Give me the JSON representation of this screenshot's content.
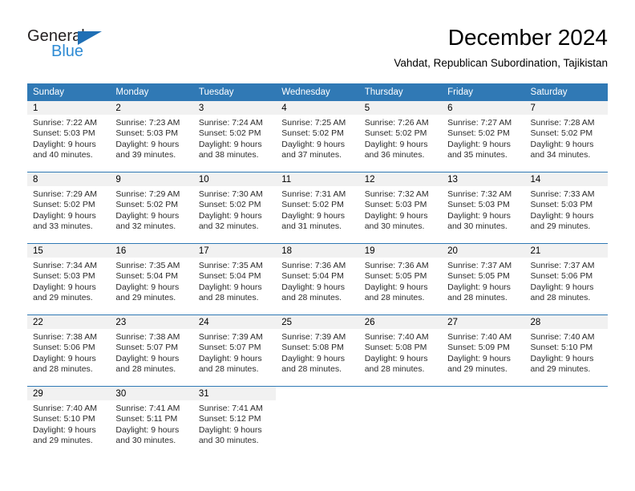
{
  "logo": {
    "text_top": "General",
    "text_bottom": "Blue",
    "triangle_color": "#1f6fb5",
    "blue_color": "#2e8bd4"
  },
  "header": {
    "title": "December 2024",
    "subtitle": "Vahdat, Republican Subordination, Tajikistan"
  },
  "theme": {
    "header_blue": "#3079b5",
    "daynum_band": "#f1f1f1",
    "text": "#000000"
  },
  "calendar": {
    "weekday_headers": [
      "Sunday",
      "Monday",
      "Tuesday",
      "Wednesday",
      "Thursday",
      "Friday",
      "Saturday"
    ],
    "weeks": [
      [
        {
          "day": "1",
          "sunrise": "Sunrise: 7:22 AM",
          "sunset": "Sunset: 5:03 PM",
          "daylight_1": "Daylight: 9 hours",
          "daylight_2": "and 40 minutes."
        },
        {
          "day": "2",
          "sunrise": "Sunrise: 7:23 AM",
          "sunset": "Sunset: 5:03 PM",
          "daylight_1": "Daylight: 9 hours",
          "daylight_2": "and 39 minutes."
        },
        {
          "day": "3",
          "sunrise": "Sunrise: 7:24 AM",
          "sunset": "Sunset: 5:02 PM",
          "daylight_1": "Daylight: 9 hours",
          "daylight_2": "and 38 minutes."
        },
        {
          "day": "4",
          "sunrise": "Sunrise: 7:25 AM",
          "sunset": "Sunset: 5:02 PM",
          "daylight_1": "Daylight: 9 hours",
          "daylight_2": "and 37 minutes."
        },
        {
          "day": "5",
          "sunrise": "Sunrise: 7:26 AM",
          "sunset": "Sunset: 5:02 PM",
          "daylight_1": "Daylight: 9 hours",
          "daylight_2": "and 36 minutes."
        },
        {
          "day": "6",
          "sunrise": "Sunrise: 7:27 AM",
          "sunset": "Sunset: 5:02 PM",
          "daylight_1": "Daylight: 9 hours",
          "daylight_2": "and 35 minutes."
        },
        {
          "day": "7",
          "sunrise": "Sunrise: 7:28 AM",
          "sunset": "Sunset: 5:02 PM",
          "daylight_1": "Daylight: 9 hours",
          "daylight_2": "and 34 minutes."
        }
      ],
      [
        {
          "day": "8",
          "sunrise": "Sunrise: 7:29 AM",
          "sunset": "Sunset: 5:02 PM",
          "daylight_1": "Daylight: 9 hours",
          "daylight_2": "and 33 minutes."
        },
        {
          "day": "9",
          "sunrise": "Sunrise: 7:29 AM",
          "sunset": "Sunset: 5:02 PM",
          "daylight_1": "Daylight: 9 hours",
          "daylight_2": "and 32 minutes."
        },
        {
          "day": "10",
          "sunrise": "Sunrise: 7:30 AM",
          "sunset": "Sunset: 5:02 PM",
          "daylight_1": "Daylight: 9 hours",
          "daylight_2": "and 32 minutes."
        },
        {
          "day": "11",
          "sunrise": "Sunrise: 7:31 AM",
          "sunset": "Sunset: 5:02 PM",
          "daylight_1": "Daylight: 9 hours",
          "daylight_2": "and 31 minutes."
        },
        {
          "day": "12",
          "sunrise": "Sunrise: 7:32 AM",
          "sunset": "Sunset: 5:03 PM",
          "daylight_1": "Daylight: 9 hours",
          "daylight_2": "and 30 minutes."
        },
        {
          "day": "13",
          "sunrise": "Sunrise: 7:32 AM",
          "sunset": "Sunset: 5:03 PM",
          "daylight_1": "Daylight: 9 hours",
          "daylight_2": "and 30 minutes."
        },
        {
          "day": "14",
          "sunrise": "Sunrise: 7:33 AM",
          "sunset": "Sunset: 5:03 PM",
          "daylight_1": "Daylight: 9 hours",
          "daylight_2": "and 29 minutes."
        }
      ],
      [
        {
          "day": "15",
          "sunrise": "Sunrise: 7:34 AM",
          "sunset": "Sunset: 5:03 PM",
          "daylight_1": "Daylight: 9 hours",
          "daylight_2": "and 29 minutes."
        },
        {
          "day": "16",
          "sunrise": "Sunrise: 7:35 AM",
          "sunset": "Sunset: 5:04 PM",
          "daylight_1": "Daylight: 9 hours",
          "daylight_2": "and 29 minutes."
        },
        {
          "day": "17",
          "sunrise": "Sunrise: 7:35 AM",
          "sunset": "Sunset: 5:04 PM",
          "daylight_1": "Daylight: 9 hours",
          "daylight_2": "and 28 minutes."
        },
        {
          "day": "18",
          "sunrise": "Sunrise: 7:36 AM",
          "sunset": "Sunset: 5:04 PM",
          "daylight_1": "Daylight: 9 hours",
          "daylight_2": "and 28 minutes."
        },
        {
          "day": "19",
          "sunrise": "Sunrise: 7:36 AM",
          "sunset": "Sunset: 5:05 PM",
          "daylight_1": "Daylight: 9 hours",
          "daylight_2": "and 28 minutes."
        },
        {
          "day": "20",
          "sunrise": "Sunrise: 7:37 AM",
          "sunset": "Sunset: 5:05 PM",
          "daylight_1": "Daylight: 9 hours",
          "daylight_2": "and 28 minutes."
        },
        {
          "day": "21",
          "sunrise": "Sunrise: 7:37 AM",
          "sunset": "Sunset: 5:06 PM",
          "daylight_1": "Daylight: 9 hours",
          "daylight_2": "and 28 minutes."
        }
      ],
      [
        {
          "day": "22",
          "sunrise": "Sunrise: 7:38 AM",
          "sunset": "Sunset: 5:06 PM",
          "daylight_1": "Daylight: 9 hours",
          "daylight_2": "and 28 minutes."
        },
        {
          "day": "23",
          "sunrise": "Sunrise: 7:38 AM",
          "sunset": "Sunset: 5:07 PM",
          "daylight_1": "Daylight: 9 hours",
          "daylight_2": "and 28 minutes."
        },
        {
          "day": "24",
          "sunrise": "Sunrise: 7:39 AM",
          "sunset": "Sunset: 5:07 PM",
          "daylight_1": "Daylight: 9 hours",
          "daylight_2": "and 28 minutes."
        },
        {
          "day": "25",
          "sunrise": "Sunrise: 7:39 AM",
          "sunset": "Sunset: 5:08 PM",
          "daylight_1": "Daylight: 9 hours",
          "daylight_2": "and 28 minutes."
        },
        {
          "day": "26",
          "sunrise": "Sunrise: 7:40 AM",
          "sunset": "Sunset: 5:08 PM",
          "daylight_1": "Daylight: 9 hours",
          "daylight_2": "and 28 minutes."
        },
        {
          "day": "27",
          "sunrise": "Sunrise: 7:40 AM",
          "sunset": "Sunset: 5:09 PM",
          "daylight_1": "Daylight: 9 hours",
          "daylight_2": "and 29 minutes."
        },
        {
          "day": "28",
          "sunrise": "Sunrise: 7:40 AM",
          "sunset": "Sunset: 5:10 PM",
          "daylight_1": "Daylight: 9 hours",
          "daylight_2": "and 29 minutes."
        }
      ],
      [
        {
          "day": "29",
          "sunrise": "Sunrise: 7:40 AM",
          "sunset": "Sunset: 5:10 PM",
          "daylight_1": "Daylight: 9 hours",
          "daylight_2": "and 29 minutes."
        },
        {
          "day": "30",
          "sunrise": "Sunrise: 7:41 AM",
          "sunset": "Sunset: 5:11 PM",
          "daylight_1": "Daylight: 9 hours",
          "daylight_2": "and 30 minutes."
        },
        {
          "day": "31",
          "sunrise": "Sunrise: 7:41 AM",
          "sunset": "Sunset: 5:12 PM",
          "daylight_1": "Daylight: 9 hours",
          "daylight_2": "and 30 minutes."
        },
        {
          "day": "",
          "sunrise": "",
          "sunset": "",
          "daylight_1": "",
          "daylight_2": ""
        },
        {
          "day": "",
          "sunrise": "",
          "sunset": "",
          "daylight_1": "",
          "daylight_2": ""
        },
        {
          "day": "",
          "sunrise": "",
          "sunset": "",
          "daylight_1": "",
          "daylight_2": ""
        },
        {
          "day": "",
          "sunrise": "",
          "sunset": "",
          "daylight_1": "",
          "daylight_2": ""
        }
      ]
    ]
  }
}
